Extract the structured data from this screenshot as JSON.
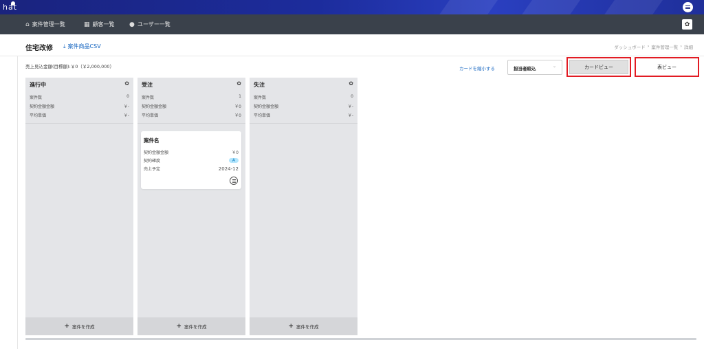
{
  "brand": {
    "logo_text": "hat"
  },
  "nav": {
    "items": [
      {
        "icon": "home-icon",
        "glyph": "⌂",
        "label": "案件管理一覧"
      },
      {
        "icon": "building-icon",
        "glyph": "▦",
        "label": "顧客一覧"
      },
      {
        "icon": "user-icon",
        "glyph": "●",
        "label": "ユーザー一覧"
      }
    ],
    "settings_icon": "gear-icon"
  },
  "header": {
    "title": "住宅改修",
    "csv_label": "案件商品CSV",
    "breadcrumb": [
      "ダッシュボード",
      "案件管理一覧",
      "詳細"
    ]
  },
  "toolbar": {
    "sales_summary": "売上見込金額(目標額):￥0（￥2,000,000）",
    "shrink_label": "カードを縮小する",
    "assignee_label": "担当者絞込",
    "card_view_label": "カードビュー",
    "table_view_label": "表ビュー"
  },
  "stat_labels": {
    "count": "案件数",
    "contract": "契約金額金額",
    "avg": "平均単価"
  },
  "columns": [
    {
      "title": "進行中",
      "count": "0",
      "contract": "￥-",
      "avg": "￥-",
      "create_label": "案件を作成"
    },
    {
      "title": "受注",
      "count": "1",
      "contract": "￥0",
      "avg": "￥0",
      "create_label": "案件を作成"
    },
    {
      "title": "失注",
      "count": "0",
      "contract": "￥-",
      "avg": "￥-",
      "create_label": "案件を作成"
    }
  ],
  "deal_card": {
    "name": "案件名",
    "contract_label": "契約金額金額",
    "contract_value": "￥0",
    "certainty_label": "契約確度",
    "certainty_value": "A",
    "sales_plan_label": "売上予定",
    "sales_plan_value": "2024-12"
  },
  "colors": {
    "accent_red": "#e21b23",
    "link_blue": "#1565c0",
    "nav_bg": "#3a414b",
    "brand_bg": "#1a237e"
  }
}
